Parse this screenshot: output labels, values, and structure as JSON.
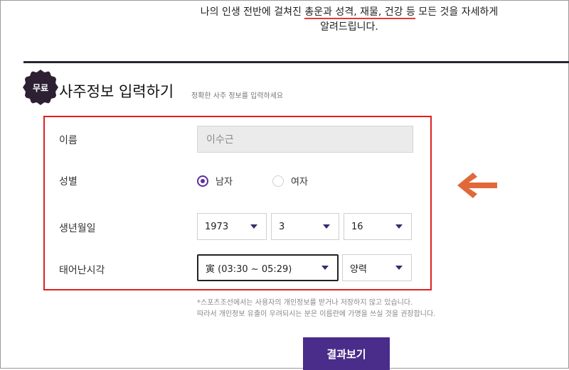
{
  "intro": {
    "line1_a": "나의 인생 전반에 걸쳐진 ",
    "line1_b": "총운과 성격, 재물, 건강 등",
    "line1_c": " 모든 것을 자세하게",
    "line2": "알려드립니다."
  },
  "section": {
    "badge": "무료",
    "title": "사주정보 입력하기",
    "subtitle": "정확한 사주 정보를 입력하세요"
  },
  "form": {
    "name_label": "이름",
    "name_value": "이수근",
    "gender_label": "성별",
    "gender_male": "남자",
    "gender_female": "여자",
    "gender_selected": "남자",
    "birth_label": "생년월일",
    "birth_year": "1973",
    "birth_month": "3",
    "birth_day": "16",
    "time_label": "태어난시각",
    "time_value": "寅 (03:30 ~ 05:29)",
    "calendar_value": "양력"
  },
  "notice": {
    "line1": "*스포츠조선에서는 사용자의 개인정보를 받거나 저장하지 않고 있습니다.",
    "line2": "따라서 개인정보 유출이 우려되시는 분은 이름란에 가명을 쓰실 것을 권장합니다."
  },
  "submit_label": "결과보기",
  "colors": {
    "accent": "#4a2c8a",
    "highlight_box": "#e02020",
    "arrow": "#e0683a"
  }
}
